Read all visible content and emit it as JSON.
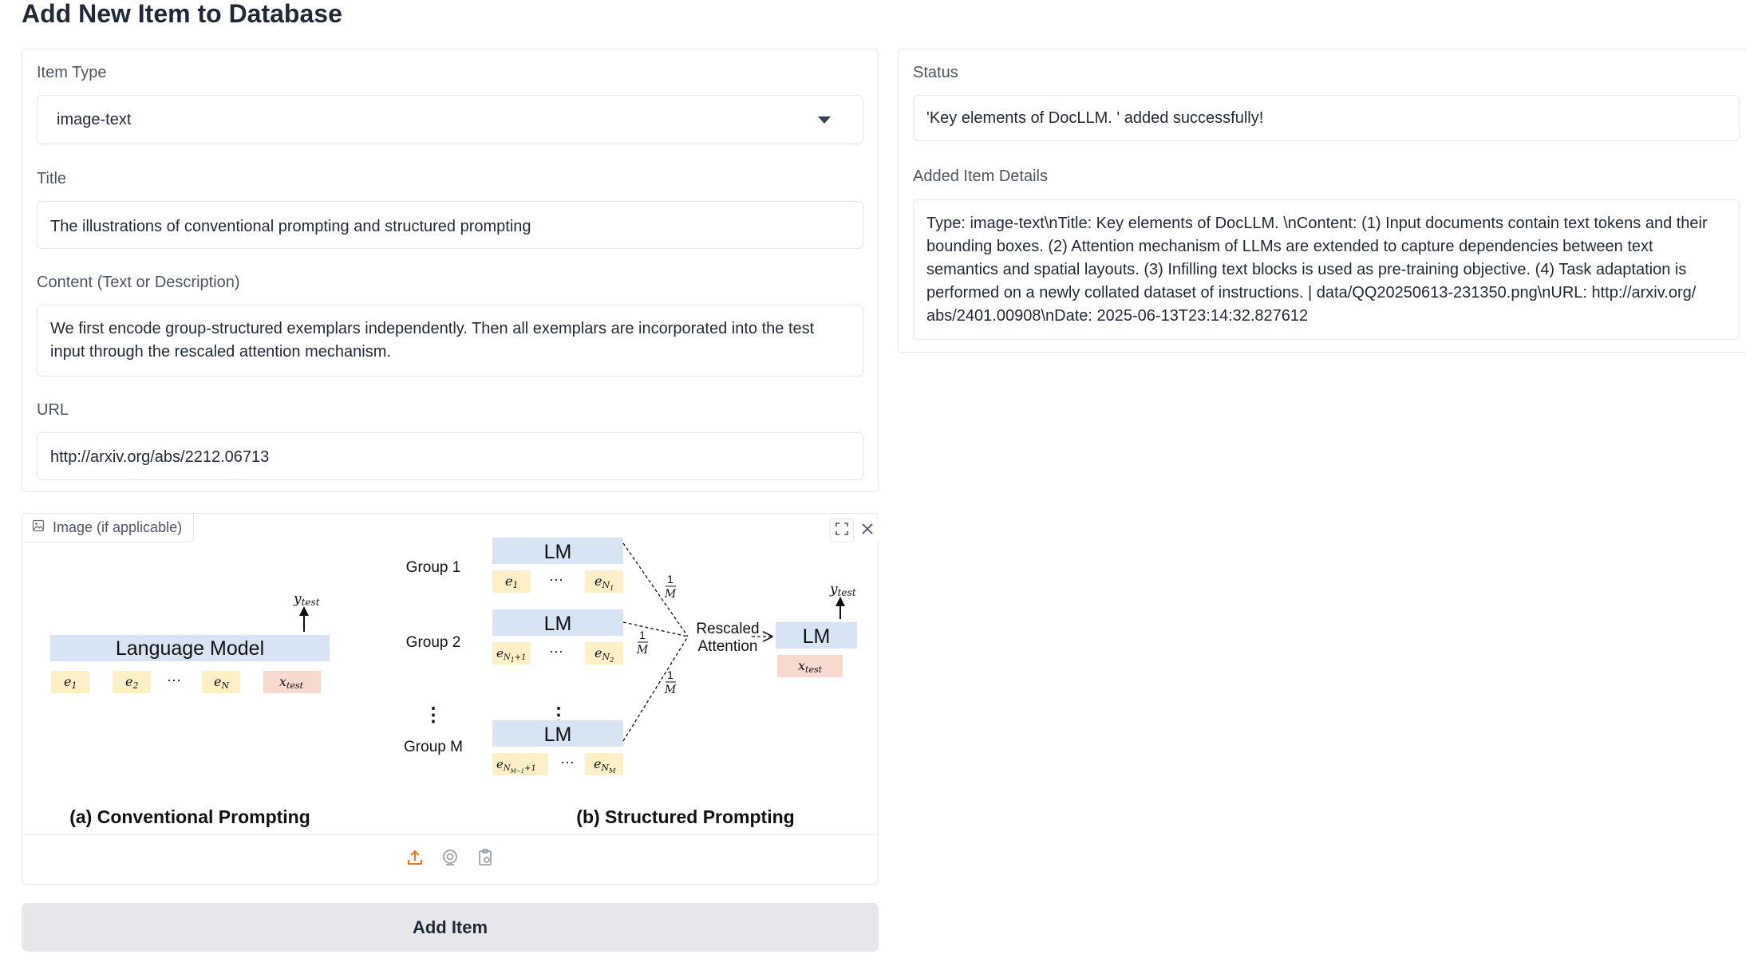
{
  "page_title": "Add New Item to Database",
  "form": {
    "item_type_label": "Item Type",
    "item_type_value": "image-text",
    "title_label": "Title",
    "title_value": "The illustrations of conventional prompting and structured prompting",
    "content_label": "Content (Text or Description)",
    "content_value": "We first encode group-structured exemplars independently. Then all exemplars are incorporated into the test input through the rescaled attention mechanism.",
    "url_label": "URL",
    "url_value": "http://arxiv.org/abs/2212.06713"
  },
  "image": {
    "label": "Image (if applicable)",
    "icons": [
      "image-icon",
      "fullscreen-icon",
      "close-icon",
      "upload-icon",
      "webcam-icon",
      "clipboard-icon"
    ],
    "figure": {
      "caption_a": "(a) Conventional Prompting",
      "caption_b": "(b) Structured Prompting",
      "language_model": "Language Model",
      "lm": "LM",
      "group_1": "Group 1",
      "group_2": "Group 2",
      "group_m": "Group M",
      "rescaled": "Rescaled",
      "attention": "Attention",
      "ellipsis": "···",
      "vdots": "⋮",
      "frac_num": "1",
      "frac_den": "M",
      "y_test": "y",
      "x_test": "x",
      "test_sub": "test",
      "e": "e",
      "sub_1": "1",
      "sub_2": "2",
      "sub_n": "N",
      "sub_n1": "N",
      "sub_n1_sub": "1",
      "sub_n2": "N",
      "sub_n2_sub": "2",
      "sub_nplus": "N",
      "sub_nplus_sub": "1",
      "sub_nplus_tail": "+1",
      "sub_nm1": "N",
      "sub_nm1_sub": "M−1",
      "sub_nm1_tail": "+1",
      "sub_nm": "N",
      "sub_nm_sub": "M"
    },
    "colors": {
      "lm_fill": "#d6e4f3",
      "token_fill": "#fdf0c6",
      "test_fill": "#f7d9d0",
      "upload_accent": "#f97316"
    }
  },
  "add_button_label": "Add Item",
  "status": {
    "label": "Status",
    "value": "'Key elements of DocLLM. ' added successfully!"
  },
  "details": {
    "label": "Added Item Details",
    "value": "Type: image-text\\nTitle: Key elements of DocLLM. \\nContent: (1) Input documents contain text tokens and their bounding boxes. (2) Attention mechanism of LLMs are extended to capture dependencies between text semantics and spatial layouts. (3) Infilling text blocks is used as pre-training objective. (4) Task adaptation is performed on a newly collated dataset of instructions. | data/QQ20250613-231350.png\\nURL: http://arxiv.org/ abs/2401.00908\\nDate: 2025-06-13T23:14:32.827612"
  }
}
